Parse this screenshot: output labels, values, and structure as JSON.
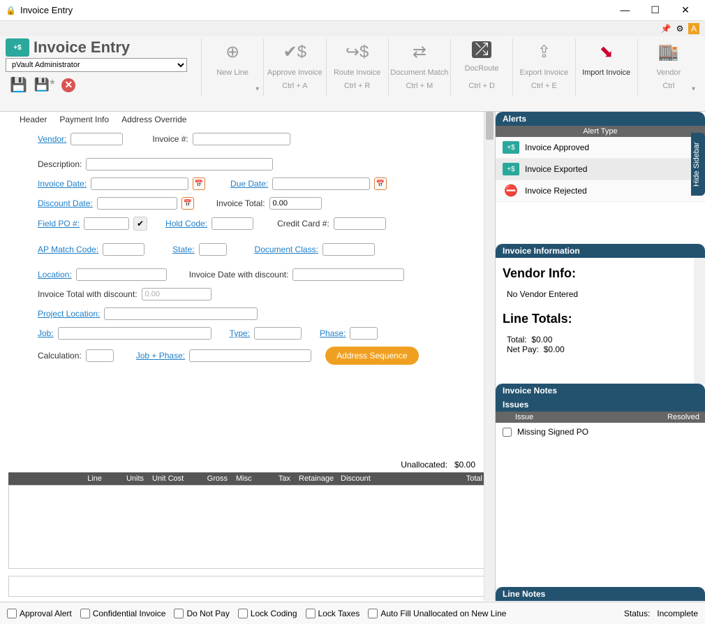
{
  "window": {
    "title": "Invoice Entry"
  },
  "ribbon": {
    "app_title": "Invoice Entry",
    "user": "pVault Administrator",
    "buttons": [
      {
        "label": "New Line",
        "shortcut": "",
        "enabled": false
      },
      {
        "label": "Approve Invoice",
        "shortcut": "Ctrl + A",
        "enabled": false
      },
      {
        "label": "Route Invoice",
        "shortcut": "Ctrl + R",
        "enabled": false
      },
      {
        "label": "Document Match",
        "shortcut": "Ctrl + M",
        "enabled": false
      },
      {
        "label": "DocRoute",
        "shortcut": "Ctrl + D",
        "enabled": false
      },
      {
        "label": "Export Invoice",
        "shortcut": "Ctrl + E",
        "enabled": false
      },
      {
        "label": "Import Invoice",
        "shortcut": "",
        "enabled": true
      },
      {
        "label": "Vendor",
        "shortcut": "Ctrl",
        "enabled": false
      }
    ]
  },
  "tabs": {
    "header": "Header",
    "payment": "Payment Info",
    "address": "Address Override"
  },
  "form": {
    "vendor_label": "Vendor:",
    "invoice_num_label": "Invoice #:",
    "description_label": "Description:",
    "invoice_date_label": "Invoice Date:",
    "due_date_label": "Due Date:",
    "discount_date_label": "Discount Date:",
    "invoice_total_label": "Invoice Total:",
    "invoice_total_value": "0.00",
    "field_po_label": "Field PO #:",
    "hold_code_label": "Hold Code:",
    "credit_card_label": "Credit Card #:",
    "ap_match_label": "AP Match Code:",
    "state_label": "State:",
    "doc_class_label": "Document Class:",
    "location_label": "Location:",
    "inv_date_disc_label": "Invoice Date with discount:",
    "inv_total_disc_label": "Invoice Total with discount:",
    "inv_total_disc_value": "0.00",
    "proj_loc_label": "Project Location:",
    "job_label": "Job:",
    "type_label": "Type:",
    "phase_label": "Phase:",
    "calculation_label": "Calculation:",
    "job_phase_label": "Job + Phase:",
    "address_seq_btn": "Address Sequence",
    "unallocated_label": "Unallocated:",
    "unallocated_value": "$0.00"
  },
  "grid": {
    "cols": {
      "line": "Line",
      "units": "Units",
      "unitcost": "Unit Cost",
      "gross": "Gross",
      "misc": "Misc",
      "tax": "Tax",
      "retainage": "Retainage",
      "discount": "Discount",
      "total": "Total"
    }
  },
  "side": {
    "alerts_title": "Alerts",
    "alert_type_label": "Alert Type",
    "alerts": [
      {
        "label": "Invoice Approved"
      },
      {
        "label": "Invoice Exported"
      },
      {
        "label": "Invoice Rejected"
      }
    ],
    "info_title": "Invoice Information",
    "vendor_info_title": "Vendor Info:",
    "no_vendor": "No Vendor Entered",
    "line_totals_title": "Line Totals:",
    "total_label": "Total:",
    "total_value": "$0.00",
    "netpay_label": "Net Pay:",
    "netpay_value": "$0.00",
    "notes_title": "Invoice Notes",
    "issues_title": "Issues",
    "issue_col": "Issue",
    "resolved_col": "Resolved",
    "issue1": "Missing Signed PO",
    "linenotes_title": "Line Notes",
    "hide_sidebar": "Hide Sidebar"
  },
  "footer": {
    "approval": "Approval Alert",
    "confidential": "Confidential Invoice",
    "donotpay": "Do Not Pay",
    "lockcoding": "Lock Coding",
    "locktaxes": "Lock Taxes",
    "autofill": "Auto Fill Unallocated on New Line",
    "status_label": "Status:",
    "status_value": "Incomplete"
  }
}
